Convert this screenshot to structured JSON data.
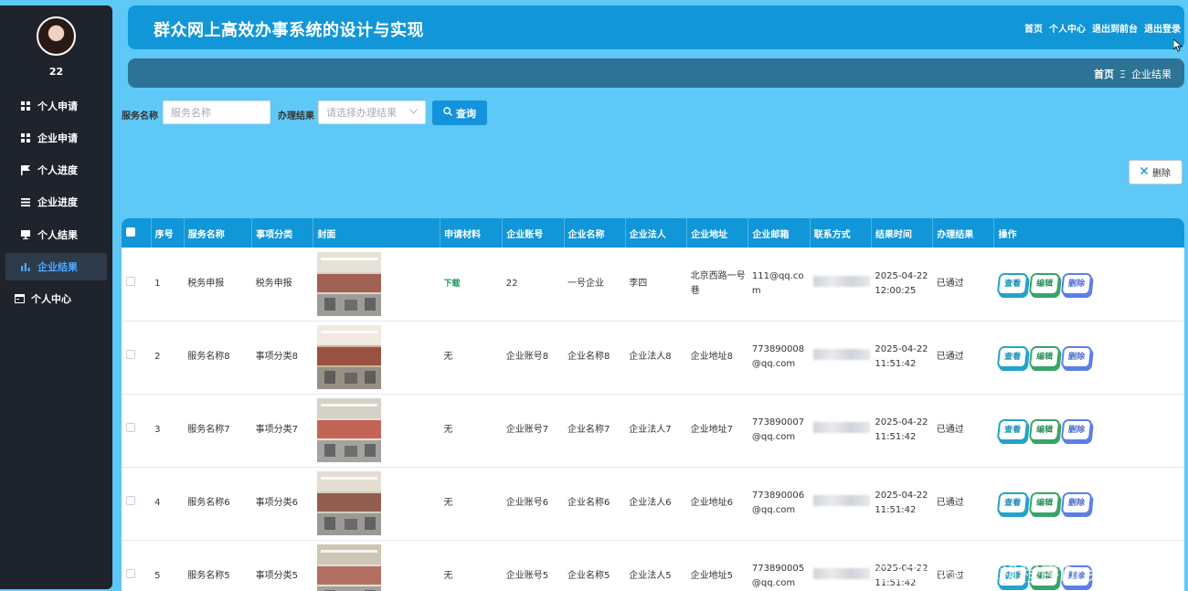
{
  "sidebar": {
    "username": "22",
    "items": [
      {
        "label": "个人申请",
        "icon": "grid-icon"
      },
      {
        "label": "企业申请",
        "icon": "grid-icon"
      },
      {
        "label": "个人进度",
        "icon": "flag-icon"
      },
      {
        "label": "企业进度",
        "icon": "list-icon"
      },
      {
        "label": "个人结果",
        "icon": "monitor-icon"
      },
      {
        "label": "企业结果",
        "icon": "bar-chart-icon"
      },
      {
        "label": "个人中心",
        "icon": "calendar-icon"
      }
    ]
  },
  "header": {
    "title": "群众网上高效办事系统的设计与实现",
    "links": [
      "首页",
      "个人中心",
      "退出到前台",
      "退出登录"
    ]
  },
  "breadcrumb": {
    "home": "首页",
    "separator": "Ξ",
    "current": "企业结果"
  },
  "search": {
    "service_label": "服务名称",
    "service_placeholder": "服务名称",
    "result_label": "办理结果",
    "result_placeholder": "请选择办理结果",
    "query_label": "查询"
  },
  "delete_label": "删除",
  "table": {
    "columns": [
      "序号",
      "服务名称",
      "事项分类",
      "封面",
      "申请材料",
      "企业账号",
      "企业名称",
      "企业法人",
      "企业地址",
      "企业邮箱",
      "联系方式",
      "结果时间",
      "办理结果",
      "操作"
    ],
    "action_labels": {
      "view": "查看",
      "edit": "编辑",
      "delete": "删除"
    },
    "rows": [
      {
        "no": "1",
        "service": "税务申报",
        "category": "税务申报",
        "material": "下载",
        "account": "22",
        "company": "一号企业",
        "legal": "李四",
        "address": "北京西路一号巷",
        "email": "111@qq.com",
        "time": "2025-04-22 12:00:25",
        "result": "已通过"
      },
      {
        "no": "2",
        "service": "服务名称8",
        "category": "事项分类8",
        "material": "无",
        "account": "企业账号8",
        "company": "企业名称8",
        "legal": "企业法人8",
        "address": "企业地址8",
        "email": "773890008@qq.com",
        "time": "2025-04-22 11:51:42",
        "result": "已通过"
      },
      {
        "no": "3",
        "service": "服务名称7",
        "category": "事项分类7",
        "material": "无",
        "account": "企业账号7",
        "company": "企业名称7",
        "legal": "企业法人7",
        "address": "企业地址7",
        "email": "773890007@qq.com",
        "time": "2025-04-22 11:51:42",
        "result": "已通过"
      },
      {
        "no": "4",
        "service": "服务名称6",
        "category": "事项分类6",
        "material": "无",
        "account": "企业账号6",
        "company": "企业名称6",
        "legal": "企业法人6",
        "address": "企业地址6",
        "email": "773890006@qq.com",
        "time": "2025-04-22 11:51:42",
        "result": "已通过"
      },
      {
        "no": "5",
        "service": "服务名称5",
        "category": "事项分类5",
        "material": "无",
        "account": "企业账号5",
        "company": "企业名称5",
        "legal": "企业法人5",
        "address": "企业地址5",
        "email": "773890005@qq.com",
        "time": "2025-04-22 11:51:42",
        "result": "已通过"
      }
    ]
  },
  "watermark": "CSDN @计算机程序Dran(接毕设)"
}
